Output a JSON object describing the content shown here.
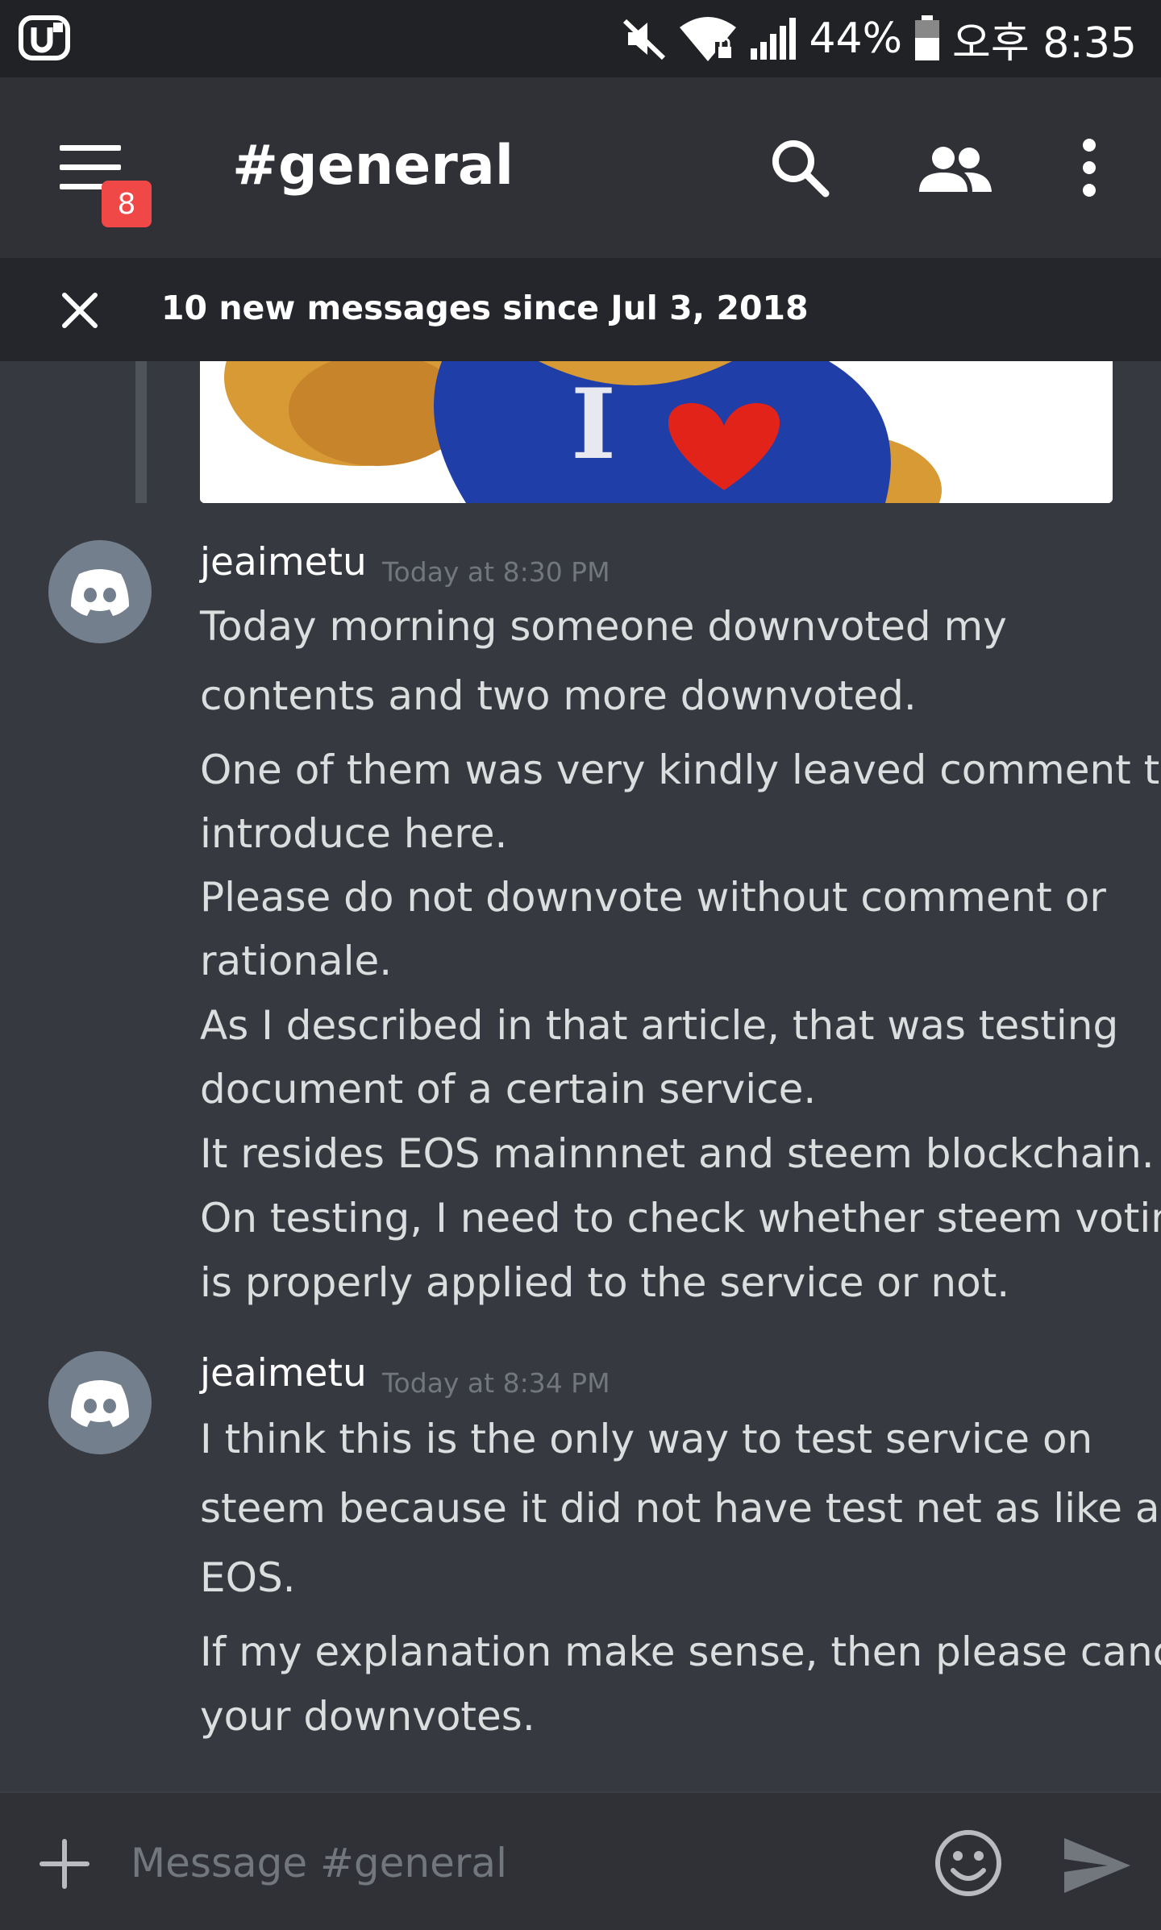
{
  "status_bar": {
    "battery": "44%",
    "time": "오후 8:35"
  },
  "header": {
    "channel": "#general",
    "badge_count": "8",
    "icons": [
      "menu-icon",
      "search-icon",
      "members-icon",
      "more-icon"
    ]
  },
  "new_messages_bar": {
    "text": "10 new messages since Jul 3, 2018"
  },
  "messages": [
    {
      "author": "jeaimetu",
      "timestamp": "Today at 8:30 PM",
      "lines": [
        "Today morning someone downvoted my",
        "contents and two more downvoted.",
        "One of them was very kindly leaved comment to",
        "introduce here.",
        "Please do not downvote without comment or",
        "rationale.",
        "As I described in that article, that was testing",
        "document of a certain service.",
        "It resides EOS mainnnet and steem blockchain.",
        "On testing, I need to check whether steem voting",
        "is properly applied to the service or not."
      ]
    },
    {
      "author": "jeaimetu",
      "timestamp": "Today at 8:34 PM",
      "lines": [
        "I think this is the only way to test service on",
        "steem because it did not have test net as like as",
        "EOS.",
        "If my explanation make sense, then please cancel",
        "your downvotes."
      ]
    }
  ],
  "embed": {
    "image_text": "I"
  },
  "input": {
    "placeholder": "Message #general"
  },
  "colors": {
    "background": "#36393f",
    "header": "#2f3136",
    "status_bar": "#202225",
    "badge": "#f04747",
    "avatar": "#747f8d"
  }
}
